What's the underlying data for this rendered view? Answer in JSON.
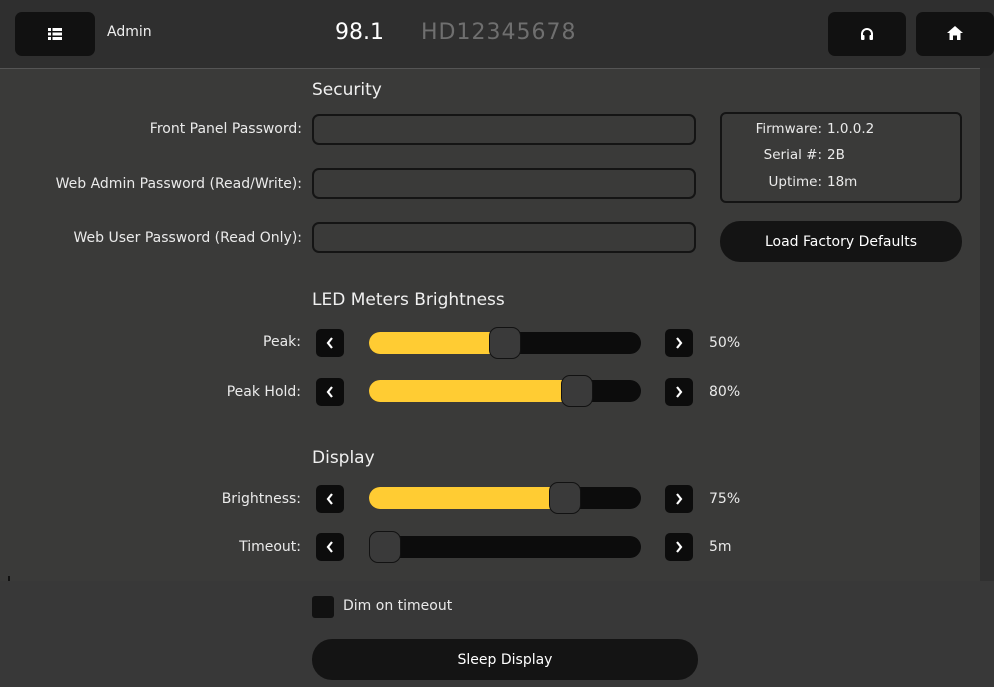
{
  "header": {
    "title": "Admin",
    "frequency": "98.1",
    "station_id": "HD12345678",
    "menu_icon": "list-icon",
    "headphones_icon": "headphones-icon",
    "home_icon": "home-icon"
  },
  "security": {
    "title": "Security",
    "front_panel_label": "Front Panel Password:",
    "web_admin_label": "Web Admin Password (Read/Write):",
    "web_user_label": "Web User Password (Read Only):",
    "front_panel_value": "",
    "web_admin_value": "",
    "web_user_value": ""
  },
  "info": {
    "firmware_key": "Firmware:",
    "firmware_value": "1.0.0.2",
    "serial_key": "Serial #:",
    "serial_value": "2B",
    "uptime_key": "Uptime:",
    "uptime_value": "18m"
  },
  "load_defaults_label": "Load Factory Defaults",
  "led": {
    "title": "LED Meters Brightness",
    "peak_label": "Peak:",
    "peak_value": "50%",
    "peak_level": 0.5,
    "peak_hold_label": "Peak Hold:",
    "peak_hold_value": "80%",
    "peak_hold_level": 0.8
  },
  "display": {
    "title": "Display",
    "brightness_label": "Brightness:",
    "brightness_value": "75%",
    "brightness_level": 0.75,
    "timeout_label": "Timeout:",
    "timeout_value": "5m",
    "timeout_level": 0.0,
    "dim_label": "Dim on timeout",
    "dim_checked": false,
    "sleep_label": "Sleep Display"
  },
  "colors": {
    "accent": "#ffcc33",
    "background": "#3a3a39",
    "button": "#141414"
  }
}
